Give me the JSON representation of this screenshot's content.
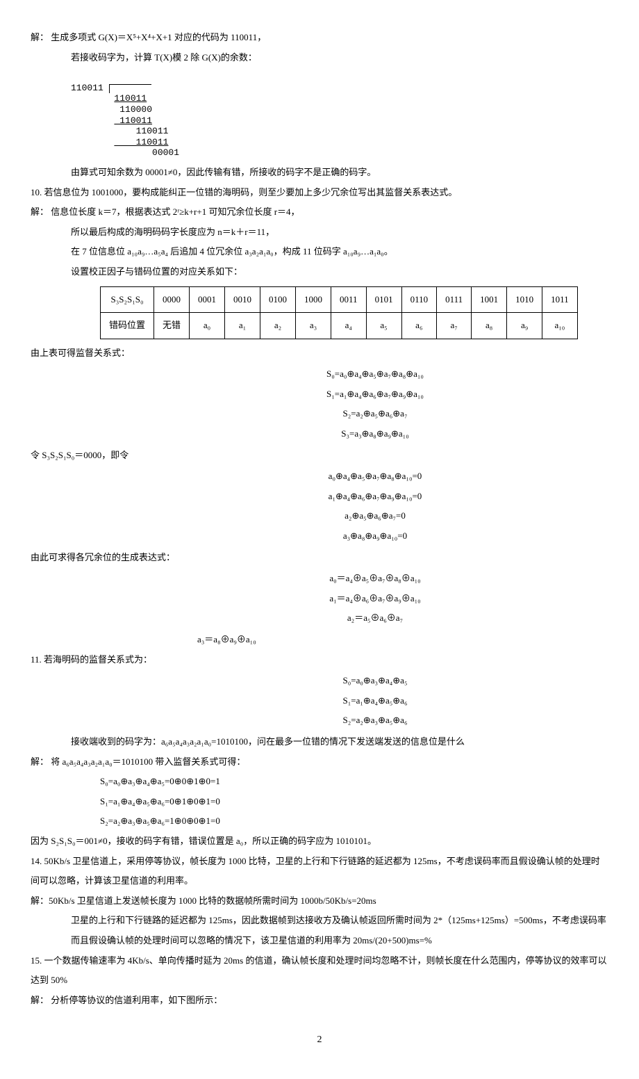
{
  "p1": "解：  生成多项式 G(X)＝X⁵+X⁴+X+1 对应的代码为 110011，",
  "p2": "若接收码字为，计算 T(X)模 2 除 G(X)的余数：",
  "longdiv": {
    "divisor": "110011",
    "l1": "110011",
    "l2": " 110000",
    "l3": " 110011",
    "l4": "    110011",
    "l5": "    110011",
    "l6": "       00001"
  },
  "p3": "由算式可知余数为 00001≠0，因此传输有错，所接收的码字不是正确的码字。",
  "p4": "10.  若信息位为 1001000，要构成能纠正一位错的海明码，则至少要加上多少冗余位写出其监督关系表达式。",
  "p5": "解：  信息位长度 k＝7，根据表达式 2ʳ≥k+r+1 可知冗余位长度 r＝4，",
  "p6": "所以最后构成的海明码码字长度应为 n＝k＋r＝11，",
  "p7": "在 7 位信息位 a₁₀a₉…a₅a₄ 后追加 4 位冗余位 a₃a₂a₁a₀，构成 11 位码字 a₁₀a₉…a₁a₀。",
  "p8": "设置校正因子与错码位置的对应关系如下：",
  "table": {
    "h": [
      "S₃S₂S₁S₀",
      "0000",
      "0001",
      "0010",
      "0100",
      "1000",
      "0011",
      "0101",
      "0110",
      "0111",
      "1001",
      "1010",
      "1011"
    ],
    "r": [
      "错码位置",
      "无错",
      "a₀",
      "a₁",
      "a₂",
      "a₃",
      "a₄",
      "a₅",
      "a₆",
      "a₇",
      "a₈",
      "a₉",
      "a₁₀"
    ]
  },
  "p9": "由上表可得监督关系式：",
  "eq1": [
    "S₀=a₀⊕a₄⊕a₅⊕a₇⊕a₈⊕a₁₀",
    "S₁=a₁⊕a₄⊕a₆⊕a₇⊕a₉⊕a₁₀",
    "S₂=a₂⊕a₅⊕a₆⊕a₇",
    "S₃=a₃⊕a₈⊕a₉⊕a₁₀"
  ],
  "p10": "令 S₃S₂S₁S₀＝0000，即令",
  "eq2": [
    "a₀⊕a₄⊕a₅⊕a₇⊕a₈⊕a₁₀=0",
    "a₁⊕a₄⊕a₆⊕a₇⊕a₉⊕a₁₀=0",
    "a₂⊕a₅⊕a₆⊕a₇=0",
    "a₃⊕a₈⊕a₉⊕a₁₀=0"
  ],
  "p11": "由此可求得各冗余位的生成表达式：",
  "eq3": [
    "a₀＝a₄⊕a₅⊕a₇⊕a₈⊕a₁₀",
    "a₁＝a₄⊕a₆⊕a₇⊕a₉⊕a₁₀",
    "a₂＝a₅⊕a₆⊕a₇"
  ],
  "eq3b": "a₃＝a₈⊕a₉⊕a₁₀",
  "p12": "11.  若海明码的监督关系式为：",
  "eq4": [
    "S₀=a₀⊕a₃⊕a₄⊕a₅",
    "S₁=a₁⊕a₄⊕a₅⊕a₆",
    "S₂=a₂⊕a₃⊕a₅⊕a₆"
  ],
  "p13": "接收端收到的码字为：a₆a₅a₄a₃a₂a₁a₀=1010100，问在最多一位错的情况下发送端发送的信息位是什么",
  "p14": "解：  将 a₆a₅a₄a₃a₂a₁a₀＝1010100 带入监督关系式可得：",
  "p15": "S₀=a₀⊕a₃⊕a₄⊕a₅=0⊕0⊕1⊕0=1",
  "p16": "S₁=a₁⊕a₄⊕a₅⊕a₆=0⊕1⊕0⊕1=0",
  "p17": "S₂=a₂⊕a₃⊕a₅⊕a₆=1⊕0⊕0⊕1=0",
  "p18": "因为 S₂S₁S₀＝001≠0，接收的码字有错，错误位置是 a₀，所以正确的码字应为 1010101。",
  "p19": "14.  50Kb/s 卫星信道上，采用停等协议，帧长度为 1000 比特，卫星的上行和下行链路的延迟都为 125ms，不考虑误码率而且假设确认帧的处理时间可以忽略，计算该卫星信道的利用率。",
  "p20": "解：50Kb/s 卫星信道上发送帧长度为 1000 比特的数据帧所需时间为 1000b/50Kb/s=20ms",
  "p21": "卫星的上行和下行链路的延迟都为 125ms，因此数据帧到达接收方及确认帧返回所需时间为 2*（125ms+125ms）=500ms，不考虑误码率而且假设确认帧的处理时间可以忽略的情况下，该卫星信道的利用率为 20ms/(20+500)ms=%",
  "p22": "15.  一个数据传输速率为 4Kb/s、单向传播时延为 20ms 的信道，确认帧长度和处理时间均忽略不计，则帧长度在什么范围内，停等协议的效率可以达到 50%",
  "p23": "解：  分析停等协议的信道利用率，如下图所示：",
  "pagenum": "2"
}
